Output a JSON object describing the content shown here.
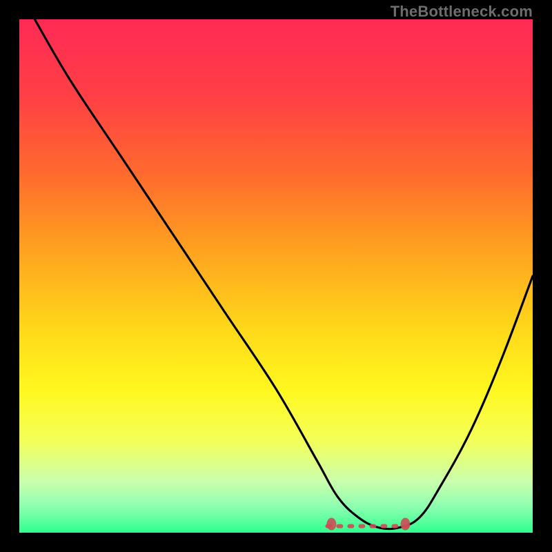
{
  "watermark": "TheBottleneck.com",
  "colors": {
    "frame": "#000000",
    "gradient_stops": [
      {
        "offset": 0.0,
        "color": "#ff2a55"
      },
      {
        "offset": 0.15,
        "color": "#ff3f45"
      },
      {
        "offset": 0.3,
        "color": "#ff6a2e"
      },
      {
        "offset": 0.45,
        "color": "#ffa21f"
      },
      {
        "offset": 0.6,
        "color": "#ffd71a"
      },
      {
        "offset": 0.72,
        "color": "#fff71e"
      },
      {
        "offset": 0.82,
        "color": "#f4ff58"
      },
      {
        "offset": 0.9,
        "color": "#caffad"
      },
      {
        "offset": 0.95,
        "color": "#8cffb0"
      },
      {
        "offset": 1.0,
        "color": "#2fff8e"
      }
    ],
    "curve": "#000000",
    "valley_marker": "#cc4d56"
  },
  "chart_data": {
    "type": "line",
    "title": "",
    "xlabel": "",
    "ylabel": "",
    "xlim": [
      0,
      100
    ],
    "ylim": [
      0,
      100
    ],
    "grid": false,
    "annotations": [
      "TheBottleneck.com"
    ],
    "series": [
      {
        "name": "bottleneck-curve",
        "x": [
          3,
          10,
          20,
          30,
          40,
          50,
          58,
          62,
          66,
          70,
          74,
          78,
          82,
          88,
          94,
          100
        ],
        "y": [
          100,
          88,
          73,
          58,
          43,
          28,
          14,
          7,
          3,
          1,
          1,
          3,
          9,
          20,
          34,
          50
        ]
      }
    ],
    "valley_flat_range_x": [
      60,
      76
    ],
    "valley_min_y": 1,
    "description": "Bottleneck percentage curve; high (red) at left, dipping to near-zero (green) around x≈66–74, then rising again toward the right."
  }
}
